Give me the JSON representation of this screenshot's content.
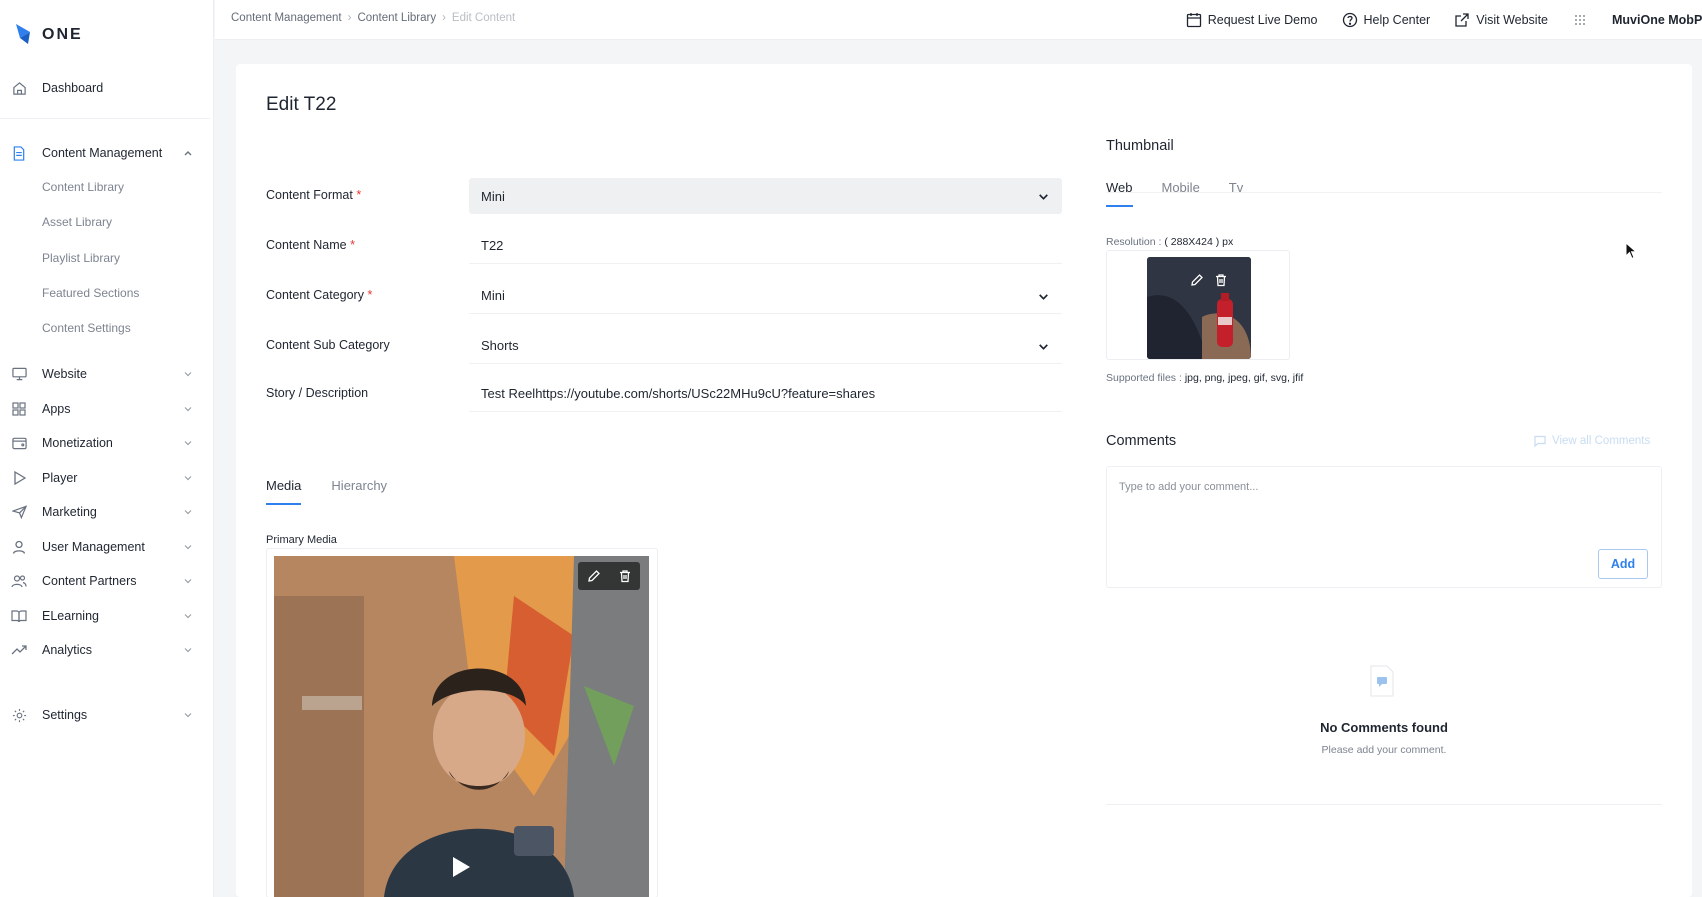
{
  "brand": {
    "logo_text": "ONE"
  },
  "sidebar": {
    "dashboard": "Dashboard",
    "content_management": "Content Management",
    "content_sub": [
      "Content Library",
      "Asset Library",
      "Playlist Library",
      "Featured Sections",
      "Content Settings"
    ],
    "sections": [
      "Website",
      "Apps",
      "Monetization",
      "Player",
      "Marketing",
      "User Management",
      "Content Partners",
      "ELearning",
      "Analytics"
    ],
    "settings": "Settings"
  },
  "breadcrumb": [
    "Content Management",
    "Content Library",
    "Edit Content"
  ],
  "topbar": {
    "request_demo": "Request Live Demo",
    "help_center": "Help Center",
    "visit_website": "Visit Website",
    "account": "MuviOne MobP"
  },
  "page": {
    "title": "Edit T22"
  },
  "form": {
    "content_format": {
      "label": "Content Format",
      "required": "*",
      "value": "Mini"
    },
    "content_name": {
      "label": "Content Name",
      "required": "*",
      "value": "T22"
    },
    "content_category": {
      "label": "Content Category",
      "required": "*",
      "value": "Mini"
    },
    "content_sub_category": {
      "label": "Content Sub Category",
      "value": "Shorts"
    },
    "story": {
      "label": "Story / Description",
      "value": "Test Reelhttps://youtube.com/shorts/USc22MHu9cU?feature=shares"
    }
  },
  "media_tabs": [
    "Media",
    "Hierarchy"
  ],
  "primary_media": {
    "label": "Primary Media"
  },
  "thumbnail": {
    "title": "Thumbnail",
    "tabs": [
      "Web",
      "Mobile",
      "Tv"
    ],
    "resolution_label": "Resolution :",
    "resolution_value": "( 288X424 ) px",
    "supported_label": "Supported files :",
    "supported_value": "jpg, png, jpeg, gif, svg, jfif"
  },
  "comments": {
    "title": "Comments",
    "view_all": "View all Comments",
    "placeholder": "Type to add your comment...",
    "add_label": "Add",
    "empty_title": "No Comments found",
    "empty_sub": "Please add your comment."
  },
  "colors": {
    "accent": "#2f80ed",
    "required": "#e53935"
  }
}
